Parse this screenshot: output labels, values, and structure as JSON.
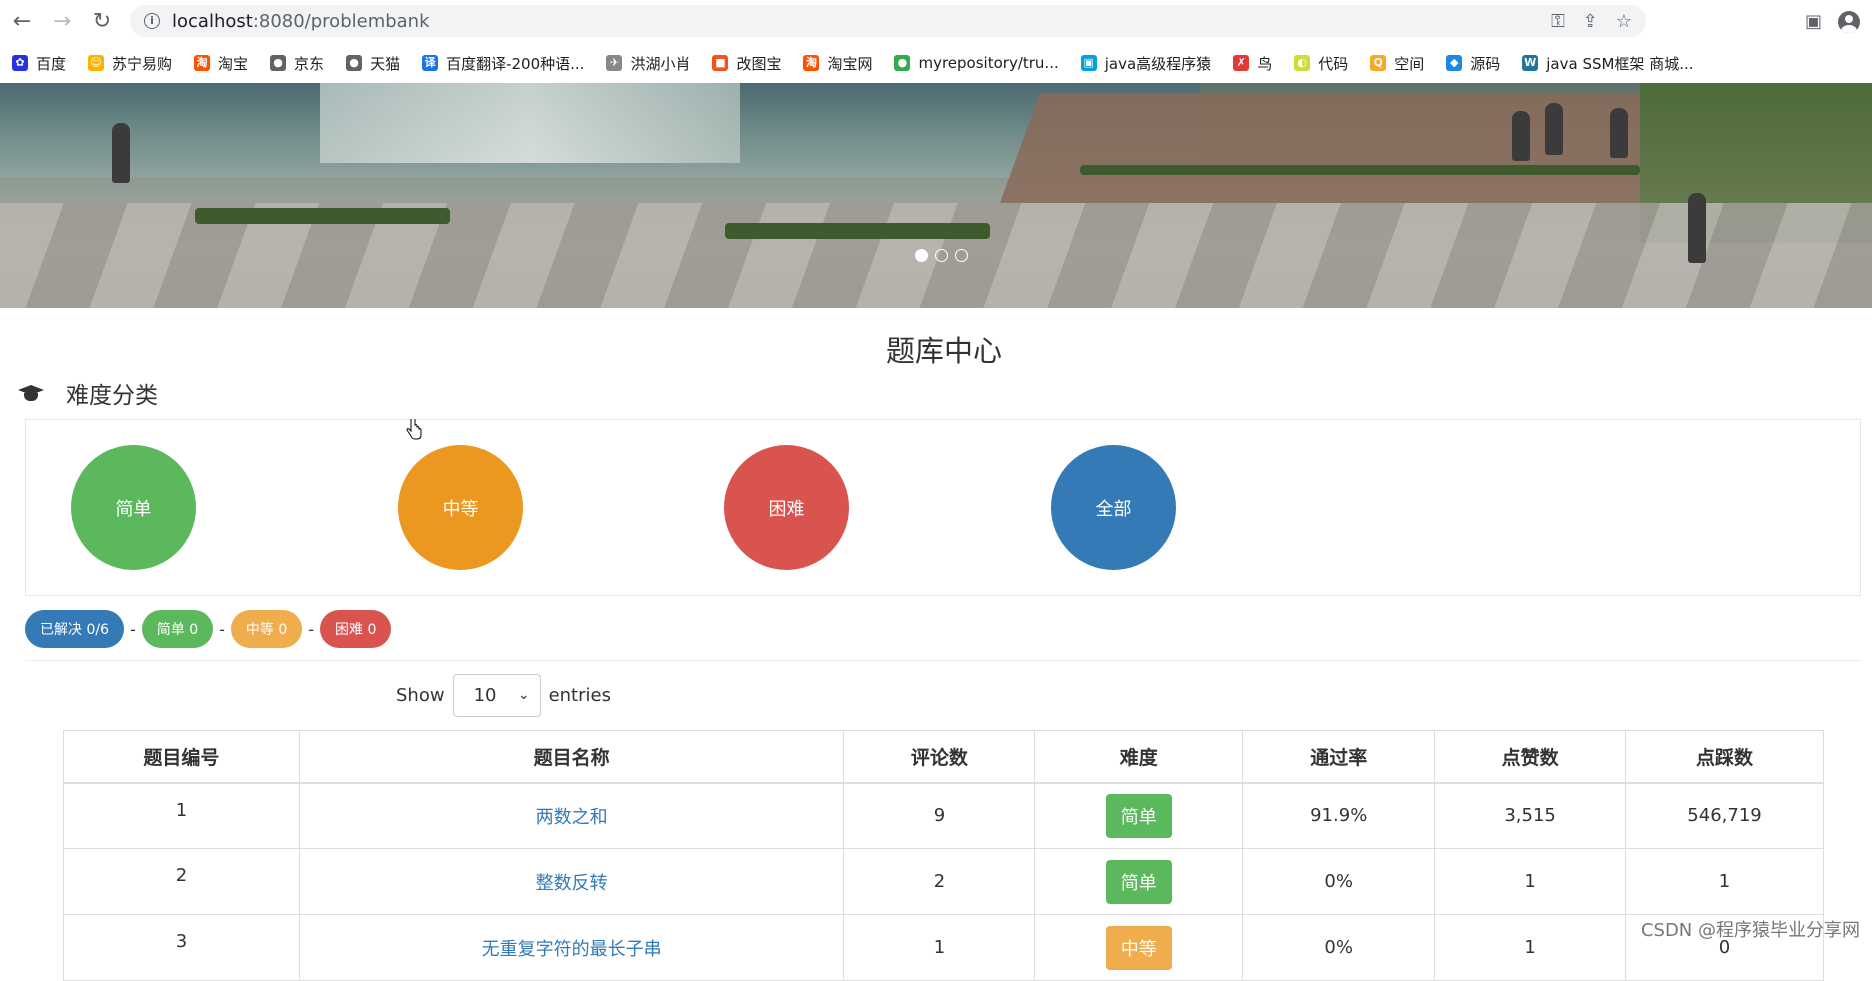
{
  "browser": {
    "url_host": "localhost",
    "url_path": ":8080/problembank",
    "bookmarks": [
      {
        "label": "百度",
        "color": "#2932e1",
        "glyph": "✿"
      },
      {
        "label": "苏宁易购",
        "color": "#f7b500",
        "glyph": "☺"
      },
      {
        "label": "淘宝",
        "color": "#ff5000",
        "glyph": "淘"
      },
      {
        "label": "京东",
        "color": "#5f6368",
        "glyph": "●"
      },
      {
        "label": "天猫",
        "color": "#5f6368",
        "glyph": "●"
      },
      {
        "label": "百度翻译-200种语...",
        "color": "#1a73e8",
        "glyph": "译"
      },
      {
        "label": "洪湖小肖",
        "color": "#888888",
        "glyph": "✈"
      },
      {
        "label": "改图宝",
        "color": "#f4511e",
        "glyph": "■"
      },
      {
        "label": "淘宝网",
        "color": "#ff5000",
        "glyph": "淘"
      },
      {
        "label": "myrepository/tru...",
        "color": "#34a853",
        "glyph": "●"
      },
      {
        "label": "java高级程序猿",
        "color": "#00a1d6",
        "glyph": "▣"
      },
      {
        "label": "鸟",
        "color": "#e53935",
        "glyph": "✗"
      },
      {
        "label": "代码",
        "color": "#cddc39",
        "glyph": "◐"
      },
      {
        "label": "空间",
        "color": "#f9a825",
        "glyph": "Q"
      },
      {
        "label": "源码",
        "color": "#1e88e5",
        "glyph": "◆"
      },
      {
        "label": "java SSM框架 商城...",
        "color": "#21759b",
        "glyph": "W"
      }
    ]
  },
  "page": {
    "title": "题库中心",
    "section_title": "难度分类"
  },
  "difficulty": [
    {
      "label": "简单",
      "color": "#5cb85c"
    },
    {
      "label": "中等",
      "color": "#ec971f"
    },
    {
      "label": "困难",
      "color": "#d9534f"
    },
    {
      "label": "全部",
      "color": "#337ab7"
    }
  ],
  "stats": {
    "solved": "已解决 0/6",
    "easy": "简单 0",
    "medium": "中等 0",
    "hard": "困难 0",
    "separator": "-"
  },
  "table_length": {
    "show": "Show",
    "value": "10",
    "entries": "entries"
  },
  "table": {
    "headers": [
      "题目编号",
      "题目名称",
      "评论数",
      "难度",
      "通过率",
      "点赞数",
      "点踩数"
    ],
    "rows": [
      {
        "id": "1",
        "name": "两数之和",
        "comments": "9",
        "level": "简单",
        "level_color": "#5cb85c",
        "pass": "91.9%",
        "likes": "3,515",
        "dislikes": "546,719"
      },
      {
        "id": "2",
        "name": "整数反转",
        "comments": "2",
        "level": "简单",
        "level_color": "#5cb85c",
        "pass": "0%",
        "likes": "1",
        "dislikes": "1"
      },
      {
        "id": "3",
        "name": "无重复字符的最长子串",
        "comments": "1",
        "level": "中等",
        "level_color": "#f0ad4e",
        "pass": "0%",
        "likes": "1",
        "dislikes": "0"
      }
    ]
  },
  "watermark": "CSDN @程序猿毕业分享网"
}
